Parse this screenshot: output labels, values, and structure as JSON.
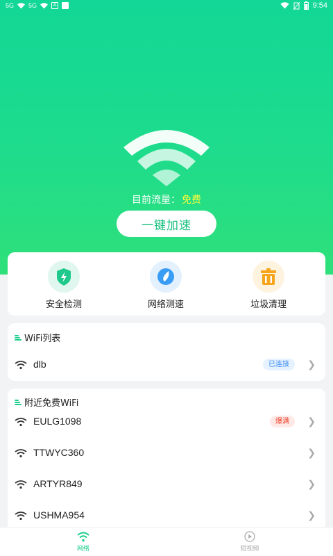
{
  "status_bar": {
    "left_items": [
      "5G",
      "wifi-icon",
      "5G",
      "wifi-icon",
      "A",
      "app-icon"
    ],
    "net1": "5G",
    "net2": "5G",
    "time": "9:54"
  },
  "hero": {
    "traffic_label": "目前流量：",
    "traffic_value": "免费",
    "boost_button": "一键加速",
    "icon": "wifi-icon"
  },
  "tools": [
    {
      "label": "安全检测",
      "icon": "shield-lightning-icon",
      "color": "#1ec98b",
      "bg": "#dff7ee"
    },
    {
      "label": "网络测速",
      "icon": "speed-icon",
      "color": "#3a9df5",
      "bg": "#e3f0fd"
    },
    {
      "label": "垃圾清理",
      "icon": "trash-icon",
      "color": "#f7a51c",
      "bg": "#fdf3df"
    }
  ],
  "wifi_list": {
    "title": "WiFi列表",
    "items": [
      {
        "name": "dlb",
        "badge": "已连接"
      }
    ]
  },
  "nearby": {
    "title": "附近免费WiFi",
    "items": [
      {
        "name": "EULG1098",
        "badge": "爆满"
      },
      {
        "name": "TTWYC360"
      },
      {
        "name": "ARTYR849"
      },
      {
        "name": "USHMA954"
      }
    ]
  },
  "tabbar": {
    "tabs": [
      {
        "label": "网络",
        "icon": "wifi-icon",
        "active": true
      },
      {
        "label": "短视频",
        "icon": "play-icon",
        "active": false
      }
    ]
  },
  "colors": {
    "accent": "#1ccf8a",
    "hero_top": "#12d796",
    "hero_bottom": "#2fe07a",
    "free_text": "#fffc3a"
  }
}
